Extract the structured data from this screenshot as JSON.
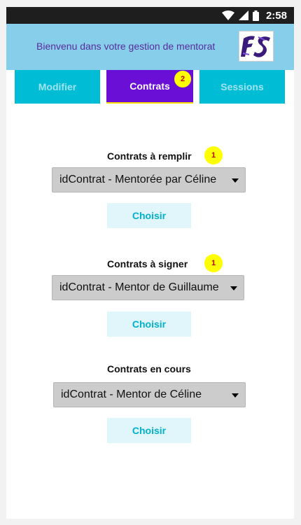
{
  "status_bar": {
    "time": "2:58",
    "icons": [
      "wifi-icon",
      "signal-icon",
      "battery-icon"
    ]
  },
  "header": {
    "title": "Bienvenu dans votre gestion de mentorat",
    "logo_text": "FS"
  },
  "tabs": [
    {
      "label": "Modifier",
      "active": false
    },
    {
      "label": "Contrats",
      "active": true,
      "badge": "2"
    },
    {
      "label": "Sessions",
      "active": false
    }
  ],
  "sections": [
    {
      "title": "Contrats à remplir",
      "badge": "1",
      "selected": "idContrat - Mentorée par Céline",
      "button": "Choisir"
    },
    {
      "title": "Contrats à signer",
      "badge": "1",
      "selected": "idContrat - Mentor de Guillaume",
      "button": "Choisir"
    },
    {
      "title": "Contrats en cours",
      "selected": "idContrat - Mentor de Céline",
      "button": "Choisir"
    }
  ],
  "colors": {
    "header_bg": "#87ceeb",
    "tab_bg": "#00bcd4",
    "tab_active_bg": "#6a0fd6",
    "badge": "#ffff00",
    "badge_text": "#c00000",
    "button_bg": "#e0f6fa",
    "button_text": "#00b0cc"
  }
}
